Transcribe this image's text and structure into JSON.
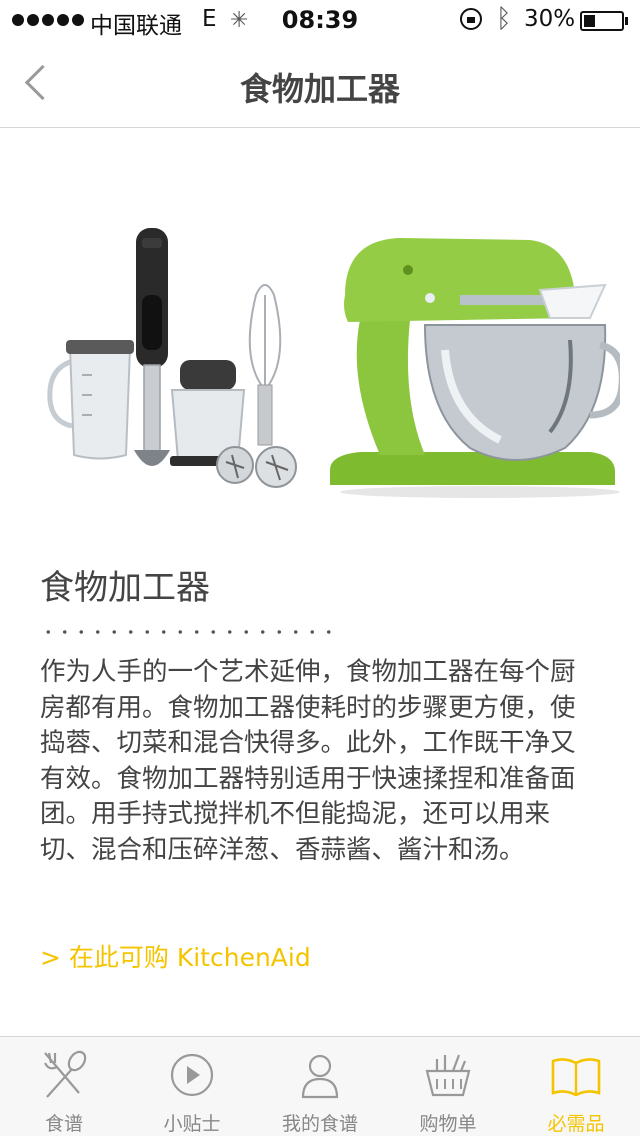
{
  "status_bar": {
    "carrier": "中国联通",
    "network": "E",
    "time": "08:39",
    "battery": "30%",
    "battery_level": 0.3
  },
  "nav": {
    "title": "食物加工器"
  },
  "product": {
    "title": "食物加工器",
    "description": "作为人手的一个艺术延伸，食物加工器在每个厨房都有用。食物加工器使耗时的步骤更方便，使捣蓉、切菜和混合快得多。此外，工作既干净又有效。食物加工器特别适用于快速揉捏和准备面团。用手持式搅拌机不但能捣泥，还可以用来切、混合和压碎洋葱、香蒜酱、酱汁和汤。",
    "buy_link": "> 在此可购 KitchenAid"
  },
  "tabs": [
    {
      "label": "食谱",
      "icon": "fork-spoon-icon"
    },
    {
      "label": "小贴士",
      "icon": "play-icon"
    },
    {
      "label": "我的食谱",
      "icon": "chef-icon"
    },
    {
      "label": "购物单",
      "icon": "basket-icon"
    },
    {
      "label": "必需品",
      "icon": "book-icon",
      "active": true
    }
  ],
  "colors": {
    "accent": "#f5c400",
    "mixer_green": "#8cc63f"
  }
}
